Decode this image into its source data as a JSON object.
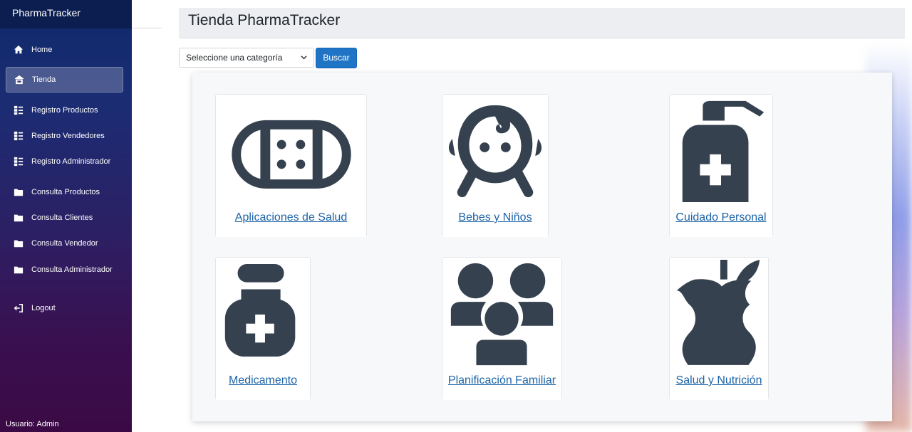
{
  "sidebar": {
    "brand": "PharmaTracker",
    "items": [
      {
        "label": "Home",
        "icon": "home-icon"
      },
      {
        "label": "Tienda",
        "icon": "store-icon",
        "active": true
      },
      {
        "label": "Registro Productos",
        "icon": "list-icon"
      },
      {
        "label": "Registro Vendedores",
        "icon": "list-icon"
      },
      {
        "label": "Registro Administrador",
        "icon": "list-icon"
      },
      {
        "label": "Consulta Productos",
        "icon": "folder-icon"
      },
      {
        "label": "Consulta Clientes",
        "icon": "folder-icon"
      },
      {
        "label": "Consulta Vendedor",
        "icon": "folder-icon"
      },
      {
        "label": "Consulta Administrador",
        "icon": "folder-icon"
      },
      {
        "label": "Logout",
        "icon": "logout-icon"
      }
    ],
    "user": "Usuario: Admin"
  },
  "header": {
    "title": "Tienda PharmaTracker"
  },
  "filter": {
    "select_value": "Seleccione una categoría",
    "search_button": "Buscar"
  },
  "categories": [
    {
      "label": "Aplicaciones de Salud",
      "icon": "bandage-icon"
    },
    {
      "label": "Bebes y Niños",
      "icon": "baby-icon"
    },
    {
      "label": "Cuidado Personal",
      "icon": "sanitizer-icon"
    },
    {
      "label": "Medicamento",
      "icon": "medicine-jar-icon"
    },
    {
      "label": "Planificación Familiar",
      "icon": "family-icon"
    },
    {
      "label": "Salud y Nutrición",
      "icon": "apple-icon"
    }
  ],
  "colors": {
    "icon": "#36414f",
    "link": "#1c64a8",
    "button": "#1f74c6"
  }
}
